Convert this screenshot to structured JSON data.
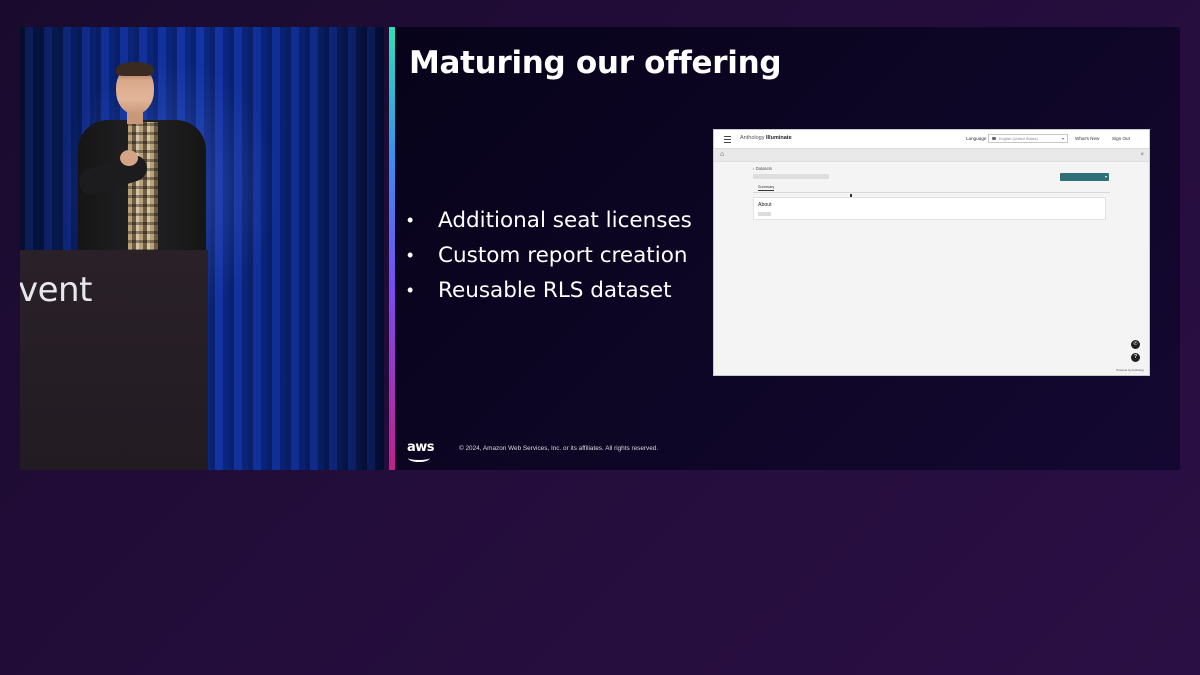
{
  "video": {
    "podium_text": "vent"
  },
  "slide": {
    "title": "Maturing our offering",
    "bullets": [
      {
        "text": "Additional seat licenses"
      },
      {
        "text": "Custom report creation"
      },
      {
        "text": "Reusable RLS dataset"
      }
    ],
    "footer": {
      "logo": "aws",
      "copyright": "© 2024, Amazon Web Services, Inc. or its affiliates. All rights reserved."
    },
    "colors": {
      "accent_top": "#2de0b7",
      "accent_mid": "#7a4af0",
      "accent_bottom": "#c21f8a",
      "background": "#0e0626"
    }
  },
  "embedded_app": {
    "brand_prefix": "Anthology",
    "brand_name": "Illuminate",
    "language_label": "Language",
    "language_value": "English (United States)",
    "whats_new": "What's New",
    "sign_out": "Sign Out",
    "back_label": "Datasets",
    "tab_label": "Summary",
    "card_title": "About",
    "powered_by": "Powered by Anthology",
    "icons": {
      "menu": "hamburger-icon",
      "home": "home-icon",
      "close": "close-icon",
      "phone": "phone-icon",
      "help": "help-icon"
    },
    "colors": {
      "primary_button": "#2e6f7a"
    }
  }
}
